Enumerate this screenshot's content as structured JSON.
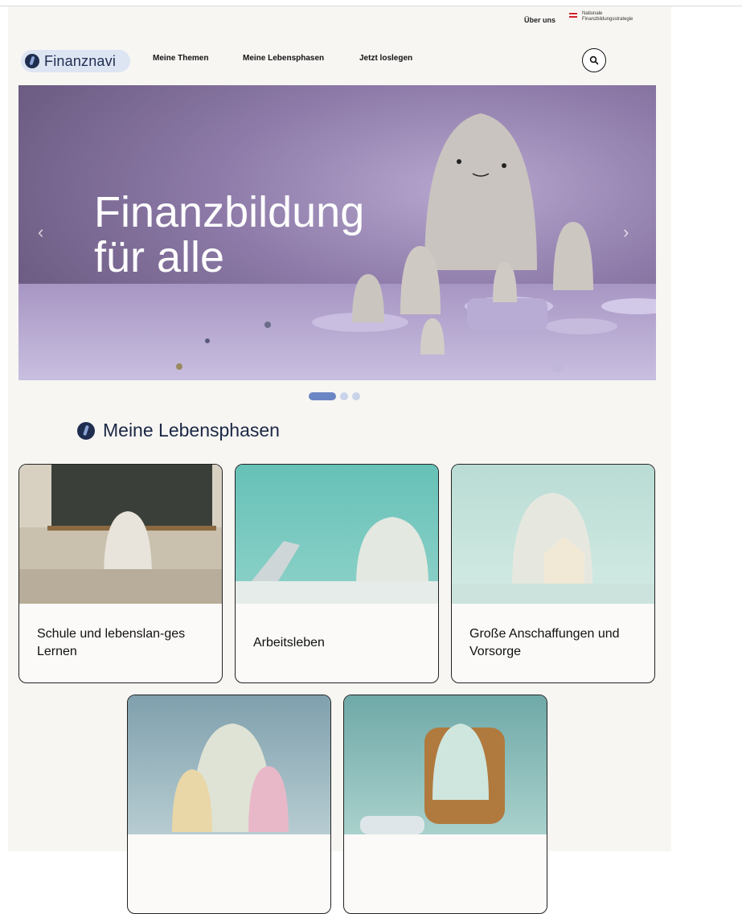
{
  "utility": {
    "about": "Über uns",
    "nfs_line1": "Nationale",
    "nfs_line2": "Finanzbildungsstrategie"
  },
  "header": {
    "logo": "Finanznavi",
    "nav": [
      "Meine Themen",
      "Meine Lebensphasen",
      "Jetzt loslegen"
    ],
    "search_icon": "search-icon"
  },
  "hero": {
    "title_line1": "Finanzbildung",
    "title_line2": "für alle",
    "prev": "‹",
    "next": "›",
    "slides": 3,
    "active_slide": 1
  },
  "lebensphasen": {
    "title": "Meine Lebensphasen",
    "cards": [
      {
        "label": "Schule und lebenslan-ges Lernen"
      },
      {
        "label": "Arbeitsleben"
      },
      {
        "label": "Große Anschaffungen und Vorsorge"
      },
      {
        "label": ""
      },
      {
        "label": ""
      }
    ]
  },
  "colors": {
    "page_bg": "#f7f6f3",
    "brand_navy": "#1f2d4f",
    "brand_blue": "#6b86c4",
    "logo_bg": "#dde5f3"
  }
}
